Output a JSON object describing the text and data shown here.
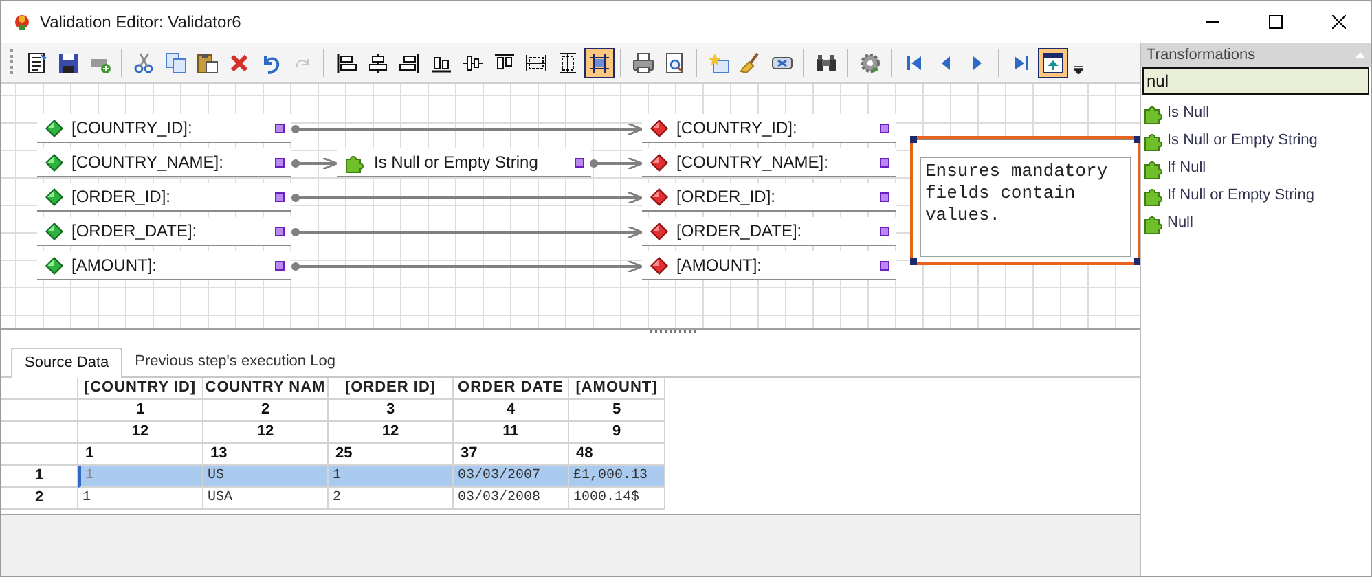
{
  "window": {
    "title": "Validation Editor: Validator6"
  },
  "toolbar": {
    "groups": [
      [
        {
          "selected": false,
          "disabled": false
        },
        {
          "selected": false,
          "disabled": false
        },
        {
          "selected": false,
          "disabled": false
        }
      ],
      [
        {
          "selected": false,
          "disabled": false
        },
        {
          "selected": false,
          "disabled": false
        },
        {
          "selected": false,
          "disabled": false
        },
        {
          "selected": false,
          "disabled": false
        },
        {
          "selected": false,
          "disabled": false
        },
        {
          "selected": false,
          "disabled": true
        }
      ],
      [
        {
          "selected": false,
          "disabled": false
        },
        {
          "selected": false,
          "disabled": false
        },
        {
          "selected": false,
          "disabled": false
        },
        {
          "selected": false,
          "disabled": false
        },
        {
          "selected": false,
          "disabled": false
        },
        {
          "selected": false,
          "disabled": false
        },
        {
          "selected": false,
          "disabled": false
        },
        {
          "selected": false,
          "disabled": false
        },
        {
          "selected": true,
          "disabled": false
        }
      ],
      [
        {
          "selected": false,
          "disabled": false
        },
        {
          "selected": false,
          "disabled": false
        }
      ],
      [
        {
          "selected": false,
          "disabled": false
        },
        {
          "selected": false,
          "disabled": false
        },
        {
          "selected": false,
          "disabled": false
        }
      ],
      [
        {
          "selected": false,
          "disabled": false
        }
      ],
      [
        {
          "selected": false,
          "disabled": false
        }
      ],
      [
        {
          "selected": false,
          "disabled": false
        },
        {
          "selected": false,
          "disabled": false
        },
        {
          "selected": false,
          "disabled": false
        }
      ],
      [
        {
          "selected": false,
          "disabled": false
        },
        {
          "selected": true,
          "disabled": false
        }
      ]
    ]
  },
  "canvas": {
    "sources": [
      {
        "label": "[COUNTRY_ID]:"
      },
      {
        "label": "[COUNTRY_NAME]:",
        "transform": {
          "label": "Is Null or Empty String"
        }
      },
      {
        "label": "[ORDER_ID]:"
      },
      {
        "label": "[ORDER_DATE]:"
      },
      {
        "label": "[AMOUNT]:"
      }
    ],
    "targets": [
      {
        "label": "[COUNTRY_ID]:"
      },
      {
        "label": "[COUNTRY_NAME]:"
      },
      {
        "label": "[ORDER_ID]:"
      },
      {
        "label": "[ORDER_DATE]:"
      },
      {
        "label": "[AMOUNT]:"
      }
    ],
    "note": {
      "text": "Ensures mandatory fields contain values.",
      "selected": true
    }
  },
  "transformations": {
    "title": "Transformations",
    "search": {
      "value": "nul"
    },
    "items": [
      {
        "label": "Is Null"
      },
      {
        "label": "Is Null or Empty String"
      },
      {
        "label": "If Null"
      },
      {
        "label": "If Null or Empty String"
      },
      {
        "label": "Null"
      }
    ]
  },
  "tabs": [
    {
      "label": "Source Data",
      "selected": true
    },
    {
      "label": "Previous step's execution Log",
      "selected": false
    }
  ],
  "table": {
    "columns": [
      "[COUNTRY ID]",
      "COUNTRY NAM",
      "[ORDER ID]",
      "ORDER DATE",
      "[AMOUNT]"
    ],
    "header_rows": [
      [
        "1",
        "2",
        "3",
        "4",
        "5"
      ],
      [
        "12",
        "12",
        "12",
        "11",
        "9"
      ],
      [
        "1",
        "13",
        "25",
        "37",
        "48"
      ]
    ],
    "rows": [
      {
        "number": "1",
        "selected": true,
        "cells": [
          "1",
          "US",
          "1",
          "03/03/2007",
          "£1,000.13"
        ]
      },
      {
        "number": "2",
        "selected": false,
        "cells": [
          "1",
          "USA",
          "2",
          "03/03/2008",
          "1000.14$"
        ]
      }
    ]
  }
}
